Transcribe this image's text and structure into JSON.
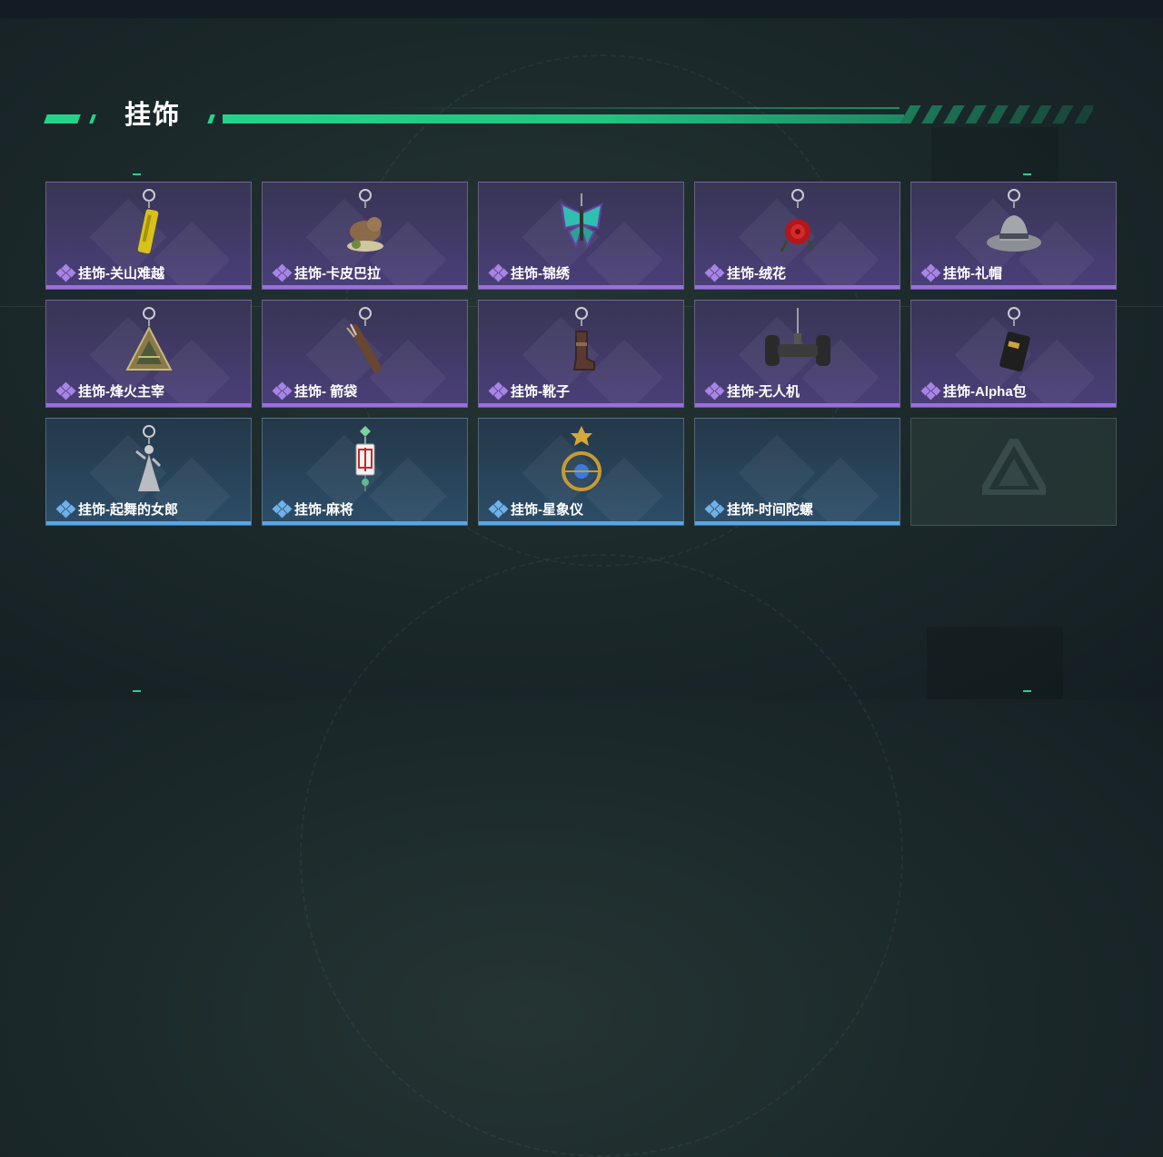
{
  "section": {
    "title": "挂饰"
  },
  "colors": {
    "accent": "#23d38a",
    "rarity_purple": "#9b6ee0",
    "rarity_blue": "#5aa6e6"
  },
  "items": [
    {
      "label": "挂饰-关山难越",
      "rarity": "purple",
      "icon": "gold-cylinder-charm-icon"
    },
    {
      "label": "挂饰-卡皮巴拉",
      "rarity": "purple",
      "icon": "capybara-charm-icon"
    },
    {
      "label": "挂饰-锦绣",
      "rarity": "purple",
      "icon": "butterfly-charm-icon"
    },
    {
      "label": "挂饰-绒花",
      "rarity": "purple",
      "icon": "rose-charm-icon"
    },
    {
      "label": "挂饰-礼帽",
      "rarity": "purple",
      "icon": "fedora-hat-charm-icon"
    },
    {
      "label": "挂饰-烽火主宰",
      "rarity": "purple",
      "icon": "triangle-emblem-charm-icon"
    },
    {
      "label": "挂饰- 箭袋",
      "rarity": "purple",
      "icon": "quiver-charm-icon"
    },
    {
      "label": "挂饰-靴子",
      "rarity": "purple",
      "icon": "boot-charm-icon"
    },
    {
      "label": "挂饰-无人机",
      "rarity": "purple",
      "icon": "drone-charm-icon"
    },
    {
      "label": "挂饰-Alpha包",
      "rarity": "purple",
      "icon": "pouch-charm-icon"
    },
    {
      "label": "挂饰-起舞的女郎",
      "rarity": "blue",
      "icon": "dancer-figure-charm-icon"
    },
    {
      "label": "挂饰-麻将",
      "rarity": "blue",
      "icon": "mahjong-tile-charm-icon"
    },
    {
      "label": "挂饰-星象仪",
      "rarity": "blue",
      "icon": "astrolabe-charm-icon"
    },
    {
      "label": "挂饰-时间陀螺",
      "rarity": "blue",
      "icon": ""
    },
    {
      "label": "",
      "rarity": "empty",
      "icon": "placeholder-logo-icon"
    }
  ]
}
